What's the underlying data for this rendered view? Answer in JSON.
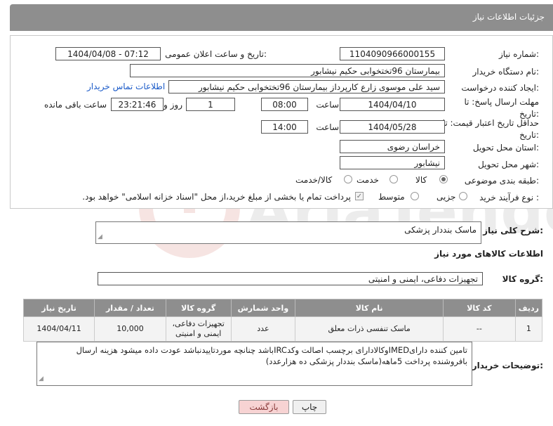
{
  "header": {
    "title": "جزئیات اطلاعات نیاز"
  },
  "fields": {
    "need_number_label": "شماره نیاز:",
    "need_number": "1104090966000155",
    "announce_label": "تاریخ و ساعت اعلان عمومی:",
    "announce_value": "1404/04/08 - 07:12",
    "buyer_org_label": "نام دستگاه خریدار:",
    "buyer_org": "بیمارستان 96تختخوابی حکیم نیشابور",
    "requester_label": "ایجاد کننده درخواست:",
    "requester": "سید علی  موسوی زارع کارپرداز بیمارستان 96تختخوابی حکیم نیشابور",
    "contact_link": "اطلاعات تماس خریدار",
    "reply_deadline_label": "مهلت ارسال پاسخ: تا تاریخ:",
    "reply_date": "1404/04/10",
    "time_label": "ساعت",
    "reply_time": "08:00",
    "days_value": "1",
    "days_label": "روز و",
    "remaining_value": "23:21:46",
    "remaining_label": "ساعت باقی مانده",
    "price_validity_label": "حداقل تاریخ اعتبار قیمت: تا تاریخ:",
    "price_date": "1404/05/28",
    "price_time": "14:00",
    "province_label": "استان محل تحویل:",
    "province": "خراسان رضوی",
    "city_label": "شهر محل تحویل:",
    "city": "نیشابور",
    "category_label": "طبقه بندی موضوعی:",
    "category_options": [
      "کالا",
      "خدمت",
      "کالا/خدمت"
    ],
    "purchase_type_label": "نوع فرآیند خرید :",
    "purchase_options": [
      "جزیی",
      "متوسط"
    ],
    "payment_note": "پرداخت تمام یا بخشی از مبلغ خرید،از محل \"اسناد خزانه اسلامی\" خواهد بود."
  },
  "description": {
    "label": "شرح کلی نیاز:",
    "value": "ماسک بنددار پزشکی"
  },
  "goods": {
    "heading": "اطلاعات کالاهای مورد نیاز",
    "group_label": "گروه کالا:",
    "group_value": "تجهیزات دفاعی، ایمنی و امنیتی",
    "columns": [
      "ردیف",
      "کد کالا",
      "نام کالا",
      "واحد شمارش",
      "گروه کالا",
      "تعداد / مقدار",
      "تاریخ نیاز"
    ],
    "row": {
      "index": "1",
      "code": "--",
      "name": "ماسک تنفسی ذرات معلق",
      "unit": "عدد",
      "group": "تجهیزات دفاعی، ایمنی و امنیتی",
      "quantity": "10,000",
      "date": "1404/04/11"
    }
  },
  "buyer_notes": {
    "label": "توضیحات خریدار:",
    "value": "تامین کننده دارایIMEDوکالادارای برچسب اصالت وکدIRCباشد چنانچه موردتاییدنباشد عودت داده میشود هزینه ارسال بافروشنده پرداخت 5ماهه(ماسک بنددار پزشکی ده هزارعدد)"
  },
  "buttons": {
    "print": "چاپ",
    "back": "بازگشت"
  },
  "colors": {
    "header_bg": "#8e8e8e",
    "link": "#1a5ac8",
    "back_button": "#f7d3d3",
    "print_button": "#f0f0f0"
  }
}
